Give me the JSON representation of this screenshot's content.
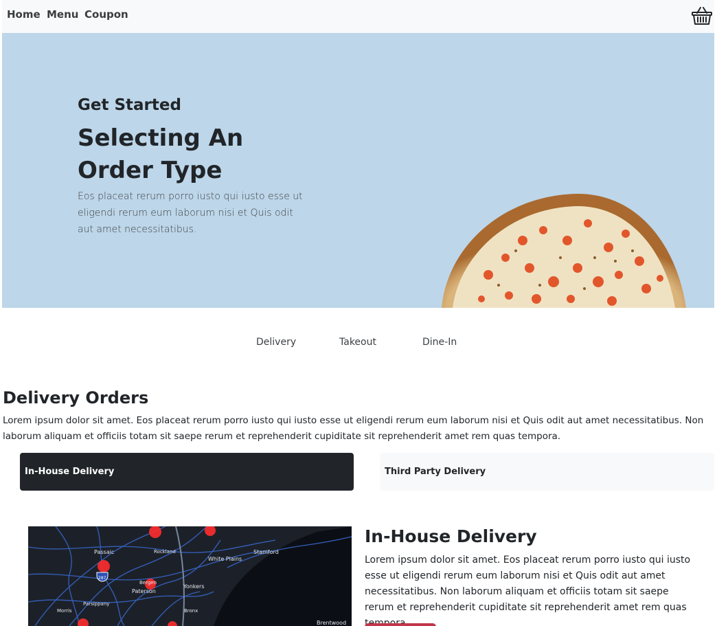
{
  "nav": {
    "links": [
      "Home",
      "Menu",
      "Coupon"
    ],
    "cart_icon": "basket-icon"
  },
  "hero": {
    "kicker": "Get Started",
    "title": "Selecting An Order Type",
    "text": "Eos placeat rerum porro iusto qui iusto esse ut eligendi rerum eum laborum nisi et Quis odit aut amet necessitatibus.",
    "background": "#bdd6e9"
  },
  "order_tabs": [
    "Delivery",
    "Takeout",
    "Dine-In"
  ],
  "delivery": {
    "title": "Delivery Orders",
    "text": "Lorem ipsum dolor sit amet. Eos placeat rerum porro iusto qui iusto esse ut eligendi rerum eum laborum nisi et Quis odit aut amet necessitatibus. Non laborum aliquam et officiis totam sit saepe rerum et reprehenderit cupiditate sit reprehenderit amet rem quas tempora.",
    "subtabs": [
      {
        "label": "In-House Delivery",
        "active": true
      },
      {
        "label": "Third Party Delivery",
        "active": false
      }
    ],
    "map_labels": [
      "Passaic",
      "White Plains",
      "Stamford",
      "Paterson",
      "Yonkers",
      "Parsippany",
      "Brentwood",
      "287",
      "Morris",
      "Bronx",
      "Bergen",
      "Rockland"
    ],
    "detail": {
      "title": "In-House Delivery",
      "text": "Lorem ipsum dolor sit amet. Eos placeat rerum porro iusto qui iusto esse ut eligendi rerum eum laborum nisi et Quis odit aut amet necessitatibus. Non laborum aliquam et officiis totam sit saepe rerum et reprehenderit cupiditate sit reprehenderit amet rem quas tempora."
    }
  },
  "colors": {
    "dark": "#212529",
    "light": "#f8f9fa",
    "accent": "#c1364a"
  }
}
